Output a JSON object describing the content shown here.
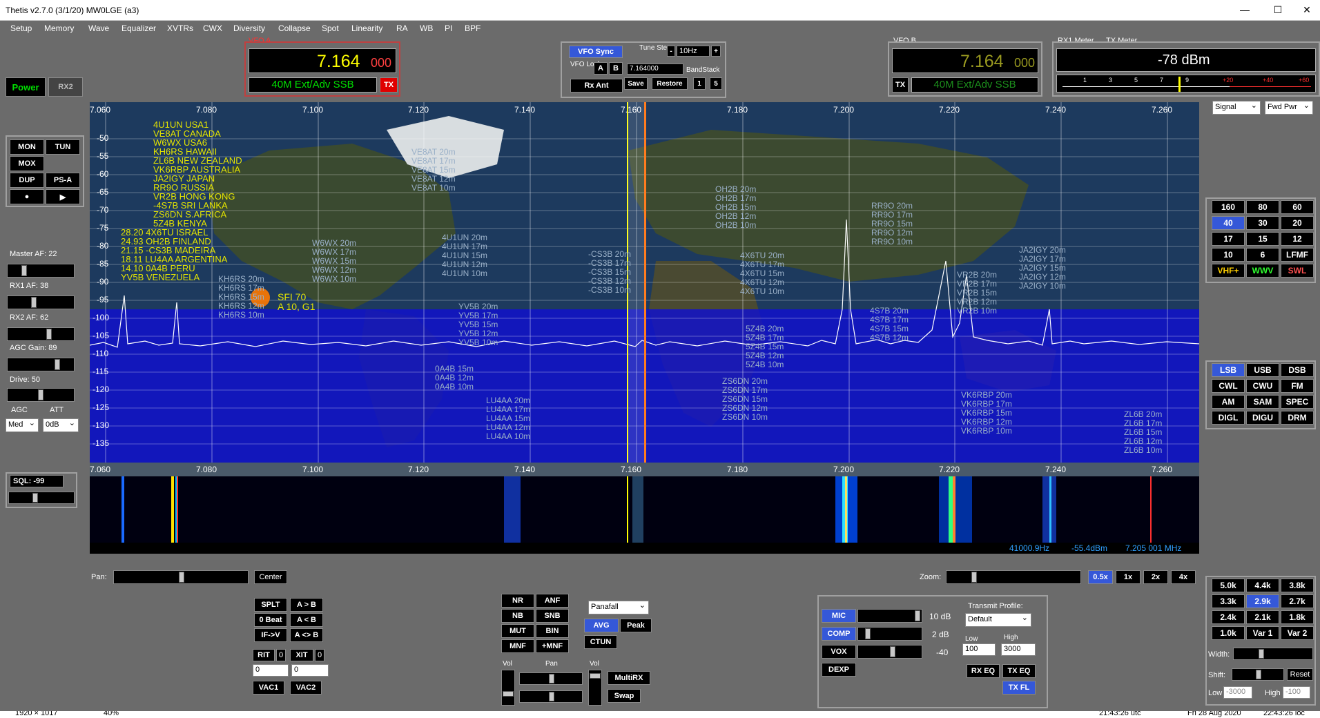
{
  "title": "Thetis v2.7.0 (3/1/20) MW0LGE (a3)",
  "menu": [
    "Setup",
    "Memory",
    "Wave",
    "Equalizer",
    "XVTRs",
    "CWX",
    "Diversity",
    "Collapse",
    "Spot",
    "Linearity",
    "RA",
    "WB",
    "PI",
    "BPF"
  ],
  "power": {
    "power_label": "Power",
    "rx2_label": "RX2"
  },
  "vfo_a": {
    "label": "VFO A",
    "freq_main": "7.164",
    "freq_sub": "000",
    "mode": "40M Ext/Adv SSB",
    "tx": "TX"
  },
  "vfo_b": {
    "label": "VFO B",
    "freq_main": "7.164",
    "freq_sub": "000",
    "mode": "40M Ext/Adv SSB",
    "tx": "TX"
  },
  "vfo_center": {
    "sync": "VFO Sync",
    "tune_step_label": "Tune Step:",
    "tune_step": "10Hz",
    "minus": "-",
    "plus": "+",
    "lock_label": "VFO Lock:",
    "a": "A",
    "b": "B",
    "freq_entry": "7.164000",
    "bandstack": "BandStack",
    "rx_ant": "Rx Ant",
    "save": "Save",
    "restore": "Restore",
    "one": "1",
    "five": "5"
  },
  "meter": {
    "rx1_label": "RX1 Meter",
    "tx_label": "TX Meter",
    "reading": "-78 dBm",
    "scale": [
      "1",
      "3",
      "5",
      "7",
      "9",
      "+20",
      "+40",
      "+60"
    ],
    "rx_select": "Signal",
    "tx_select": "Fwd Pwr"
  },
  "left": {
    "mon": "MON",
    "tun": "TUN",
    "mox": "MOX",
    "dup": "DUP",
    "psa": "PS-A",
    "rec": "●",
    "play": "▶",
    "master_af": "Master AF:  22",
    "rx1_af": "RX1 AF:  38",
    "rx2_af": "RX2 AF:  62",
    "agc_gain": "AGC Gain:  89",
    "drive": "Drive:  50",
    "agc": "AGC",
    "att": "ATT",
    "agc_val": "Med",
    "att_val": "0dB",
    "sql": "SQL: -99"
  },
  "spectrum": {
    "freqs": [
      "7.060",
      "7.080",
      "7.100",
      "7.120",
      "7.140",
      "7.160",
      "7.180",
      "7.200",
      "7.220",
      "7.240",
      "7.260"
    ],
    "db": [
      "-50",
      "-55",
      "-60",
      "-65",
      "-70",
      "-75",
      "-80",
      "-85",
      "-90",
      "-95",
      "-100",
      "-105",
      "-110",
      "-115",
      "-120",
      "-125",
      "-130",
      "-135"
    ],
    "beacons": [
      "4U1UN USA1",
      "VE8AT CANADA",
      "W6WX USA6",
      "KH6RS HAWAII",
      "ZL6B NEW ZEALAND",
      "VK6RBP AUSTRALIA",
      "JA2IGY JAPAN",
      "RR9O RUSSIA",
      "VR2B HONG KONG",
      "-4S7B SRI LANKA",
      "ZS6DN S.AFRICA",
      "5Z4B KENYA",
      "28.20  4X6TU ISRAEL",
      "24.93  OH2B FINLAND",
      "21.15  -CS3B MADEIRA",
      "18.11  LU4AA ARGENTINA",
      "14.10  0A4B PERU",
      "YV5B VENEZUELA"
    ],
    "sfi": "SFI 70",
    "aindex": "A 10, G1",
    "status_hz": "41000.9Hz",
    "status_dbm": "-55.4dBm",
    "status_mhz": "7.205 001 MHz"
  },
  "spots": [
    {
      "text": "VE8AT 20m\nVE8AT 17m\nVE8AT 15m\nVE8AT 12m\nVE8AT 10m"
    },
    {
      "text": "W6WX 20m\nW6WX 17m\nW6WX 15m\nW6WX 12m\nW6WX 10m"
    },
    {
      "text": "KH6RS 20m\nKH6RS 17m\nKH6RS 15m\nKH6RS 12m\nKH6RS 10m"
    },
    {
      "text": "4U1UN 20m\n4U1UN 17m\n4U1UN 15m\n4U1UN 12m\n4U1UN 10m"
    },
    {
      "text": "YV5B 20m\nYV5B 17m\nYV5B 15m\nYV5B 12m\nYV5B 10m"
    },
    {
      "text": "-CS3B 20m\n-CS3B 17m\n-CS3B 15m\n-CS3B 12m\n-CS3B 10m"
    },
    {
      "text": "OH2B 20m\nOH2B 17m\nOH2B 15m\nOH2B 12m\nOH2B 10m"
    },
    {
      "text": "4X6TU 20m\n4X6TU 17m\n4X6TU 15m\n4X6TU 12m\n4X6TU 10m"
    },
    {
      "text": "RR9O 20m\nRR9O 17m\nRR9O 15m\nRR9O 12m\nRR9O 10m"
    },
    {
      "text": "5Z4B 20m\n5Z4B 17m\n5Z4B 15m\n5Z4B 12m\n5Z4B 10m"
    },
    {
      "text": "4S7B 20m\n4S7B 17m\n4S7B 15m\n4S7B 12m"
    },
    {
      "text": "VR2B 20m\nVR2B 17m\nVR2B 15m\nVR2B 12m\nVR2B 10m"
    },
    {
      "text": "JA2IGY 20m\nJA2IGY 17m\nJA2IGY 15m\nJA2IGY 12m\nJA2IGY 10m"
    },
    {
      "text": "0A4B 15m\n0A4B 12m\n0A4B 10m"
    },
    {
      "text": "LU4AA 20m\nLU4AA 17m\nLU4AA 15m\nLU4AA 12m\nLU4AA 10m"
    },
    {
      "text": "ZS6DN 20m\nZS6DN 17m\nZS6DN 15m\nZS6DN 12m\nZS6DN 10m"
    },
    {
      "text": "VK6RBP 20m\nVK6RBP 17m\nVK6RBP 15m\nVK6RBP 12m\nVK6RBP 10m"
    },
    {
      "text": "ZL6B 20m\nZL6B 17m\nZL6B 15m\nZL6B 12m\nZL6B 10m"
    }
  ],
  "bands": [
    "160",
    "80",
    "60",
    "40",
    "30",
    "20",
    "17",
    "15",
    "12",
    "10",
    "6",
    "LFMF",
    "VHF+",
    "WWV",
    "SWL"
  ],
  "modes": [
    "LSB",
    "USB",
    "DSB",
    "CWL",
    "CWU",
    "FM",
    "AM",
    "SAM",
    "SPEC",
    "DIGL",
    "DIGU",
    "DRM"
  ],
  "filters": [
    "5.0k",
    "4.4k",
    "3.8k",
    "3.3k",
    "2.9k",
    "2.7k",
    "2.4k",
    "2.1k",
    "1.8k",
    "1.0k",
    "Var 1",
    "Var 2"
  ],
  "filter_ctrl": {
    "width": "Width:",
    "shift": "Shift:",
    "reset": "Reset",
    "low": "Low",
    "low_val": "-3000",
    "high": "High",
    "high_val": "-100"
  },
  "bottom": {
    "pan": "Pan:",
    "center": "Center",
    "zoom": "Zoom:",
    "zooms": [
      "0.5x",
      "1x",
      "2x",
      "4x"
    ],
    "splt": "SPLT",
    "atob": "A > B",
    "zbeat": "0 Beat",
    "btoa": "A < B",
    "ifv": "IF->V",
    "aswap": "A <> B",
    "rit": "RIT",
    "rit_val": "0",
    "xit": "XIT",
    "xit_val": "0",
    "rit_entry": "0",
    "xit_entry": "0",
    "vac1": "VAC1",
    "vac2": "VAC2",
    "nr": "NR",
    "anf": "ANF",
    "nb": "NB",
    "snb": "SNB",
    "mut": "MUT",
    "bin": "BIN",
    "mnf": "MNF",
    "pmnf": "+MNF",
    "display_mode": "Panafall",
    "avg": "AVG",
    "peak": "Peak",
    "ctun": "CTUN",
    "vol": "Vol",
    "pan2": "Pan",
    "vol2": "Vol",
    "multirx": "MultiRX",
    "swap": "Swap",
    "mic": "MIC",
    "mic_db": "10 dB",
    "comp": "COMP",
    "comp_db": "2 dB",
    "vox": "VOX",
    "vox_val": "-40",
    "dexp": "DEXP",
    "tx_profile": "Transmit Profile:",
    "profile_val": "Default",
    "low": "Low",
    "high": "High",
    "low_val": "100",
    "high_val": "3000",
    "rxeq": "RX EQ",
    "txeq": "TX EQ",
    "txfl": "TX FL"
  },
  "statusbar": {
    "res": "1920 × 1017",
    "cpu": "40%",
    "utc": "21:43:26 utc",
    "date": "Fri 28 Aug 2020",
    "loc": "22:43:26 loc"
  }
}
